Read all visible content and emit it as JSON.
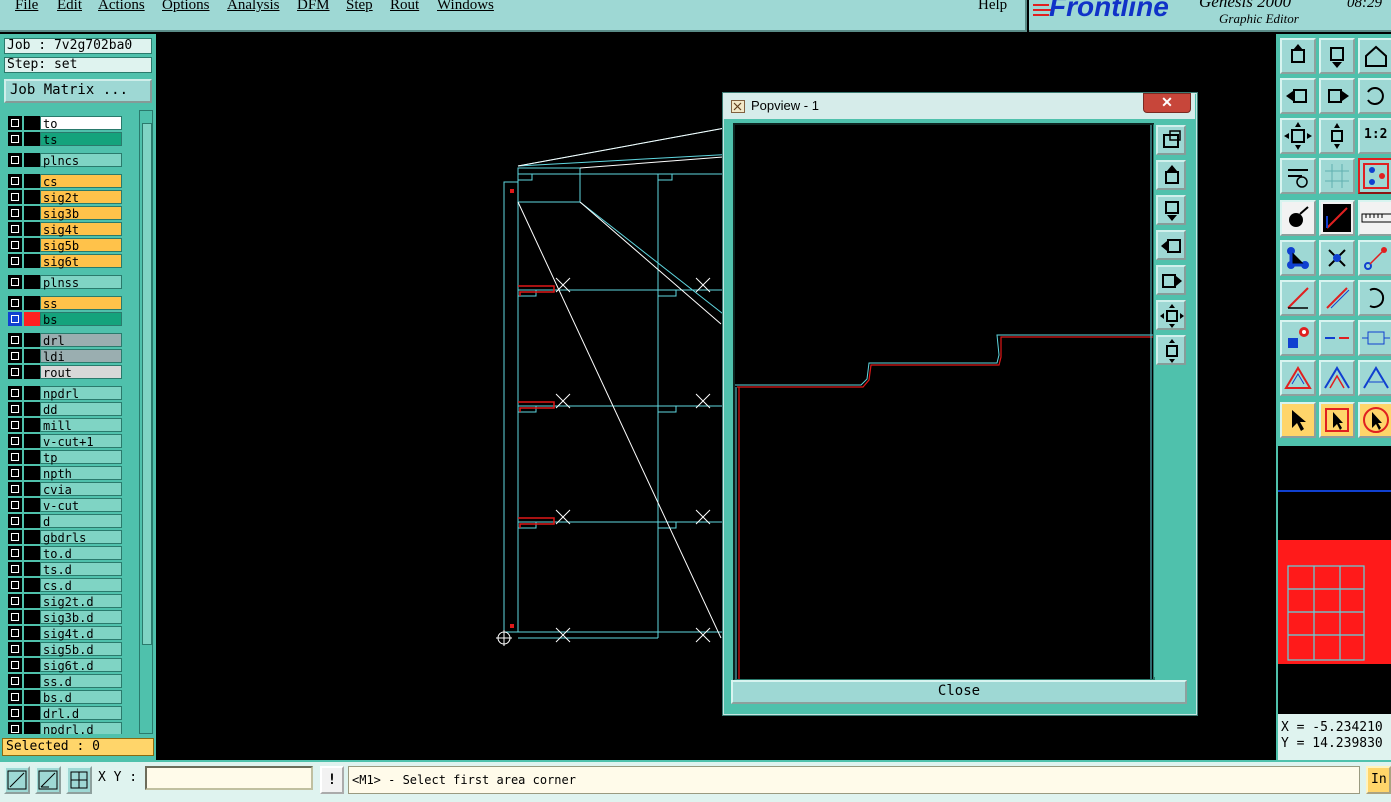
{
  "menubar": {
    "items": [
      "File",
      "Edit",
      "Actions",
      "Options",
      "Analysis",
      "DFM",
      "Step",
      "Rout",
      "Windows"
    ],
    "help": "Help"
  },
  "branding": {
    "logo": "Frontline",
    "product": "Genesis 2000",
    "subtitle": "Graphic Editor",
    "clock": "08:29"
  },
  "left_panel": {
    "job": "Job : 7v2g702ba0",
    "step": "Step: set",
    "job_matrix_button": "Job Matrix ...",
    "selected": "Selected : 0",
    "layers": [
      {
        "name": "to",
        "color": "#ffffff",
        "swatch": "#000000"
      },
      {
        "name": "ts",
        "color": "#14a37c",
        "swatch": "#000000"
      },
      {
        "name": "plncs",
        "color": "#7fd4c4",
        "swatch": "#000000"
      },
      {
        "name": "cs",
        "color": "#ffc24a",
        "swatch": "#000000"
      },
      {
        "name": "sig2t",
        "color": "#ffc24a",
        "swatch": "#000000"
      },
      {
        "name": "sig3b",
        "color": "#ffc24a",
        "swatch": "#000000"
      },
      {
        "name": "sig4t",
        "color": "#ffc24a",
        "swatch": "#000000"
      },
      {
        "name": "sig5b",
        "color": "#ffc24a",
        "swatch": "#000000"
      },
      {
        "name": "sig6t",
        "color": "#ffc24a",
        "swatch": "#000000"
      },
      {
        "name": "plnss",
        "color": "#7fd4c4",
        "swatch": "#000000"
      },
      {
        "name": "ss",
        "color": "#ffc24a",
        "swatch": "#000000"
      },
      {
        "name": "bs",
        "color": "#14a37c",
        "swatch": "#ff2020"
      },
      {
        "name": "drl",
        "color": "#9aaeb0",
        "swatch": "#000000"
      },
      {
        "name": "ldi",
        "color": "#9aaeb0",
        "swatch": "#000000"
      },
      {
        "name": "rout",
        "color": "#d8d8d8",
        "swatch": "#000000"
      },
      {
        "name": "npdrl",
        "color": "#7fd4c4",
        "swatch": "#000000"
      },
      {
        "name": "dd",
        "color": "#7fd4c4",
        "swatch": "#000000"
      },
      {
        "name": "mill",
        "color": "#7fd4c4",
        "swatch": "#000000"
      },
      {
        "name": "v-cut+1",
        "color": "#7fd4c4",
        "swatch": "#000000"
      },
      {
        "name": "tp",
        "color": "#7fd4c4",
        "swatch": "#000000"
      },
      {
        "name": "npth",
        "color": "#7fd4c4",
        "swatch": "#000000"
      },
      {
        "name": "cvia",
        "color": "#7fd4c4",
        "swatch": "#000000"
      },
      {
        "name": "v-cut",
        "color": "#7fd4c4",
        "swatch": "#000000"
      },
      {
        "name": "d",
        "color": "#7fd4c4",
        "swatch": "#000000"
      },
      {
        "name": "gbdrls",
        "color": "#7fd4c4",
        "swatch": "#000000"
      },
      {
        "name": "to.d",
        "color": "#7fd4c4",
        "swatch": "#000000"
      },
      {
        "name": "ts.d",
        "color": "#7fd4c4",
        "swatch": "#000000"
      },
      {
        "name": "cs.d",
        "color": "#7fd4c4",
        "swatch": "#000000"
      },
      {
        "name": "sig2t.d",
        "color": "#7fd4c4",
        "swatch": "#000000"
      },
      {
        "name": "sig3b.d",
        "color": "#7fd4c4",
        "swatch": "#000000"
      },
      {
        "name": "sig4t.d",
        "color": "#7fd4c4",
        "swatch": "#000000"
      },
      {
        "name": "sig5b.d",
        "color": "#7fd4c4",
        "swatch": "#000000"
      },
      {
        "name": "sig6t.d",
        "color": "#7fd4c4",
        "swatch": "#000000"
      },
      {
        "name": "ss.d",
        "color": "#7fd4c4",
        "swatch": "#000000"
      },
      {
        "name": "bs.d",
        "color": "#7fd4c4",
        "swatch": "#000000"
      },
      {
        "name": "drl.d",
        "color": "#7fd4c4",
        "swatch": "#000000"
      },
      {
        "name": "npdrl.d",
        "color": "#7fd4c4",
        "swatch": "#000000"
      }
    ]
  },
  "popview": {
    "title": "Popview - 1",
    "close_x": "✕",
    "close_button": "Close",
    "tool_icons": [
      "zoom-fit-icon",
      "zoom-up-icon",
      "zoom-down-icon",
      "zoom-left-icon",
      "zoom-right-icon",
      "zoom-out-icon",
      "zoom-in-icon"
    ]
  },
  "right_panel": {
    "zoom_labels": {
      "ratio": "1:2"
    },
    "coords": {
      "x": "X = -5.234210",
      "y": "Y = 14.239830"
    }
  },
  "bottom_bar": {
    "xy_label": "X Y :",
    "xy_value": "",
    "warn": "!",
    "prompt": "<M1> - Select first area corner",
    "info": "In"
  },
  "colors": {
    "panel": "#4fc1ac",
    "menubar": "#9ed8d4",
    "outline": "#5fd7e0",
    "feature_red": "#e01818"
  }
}
